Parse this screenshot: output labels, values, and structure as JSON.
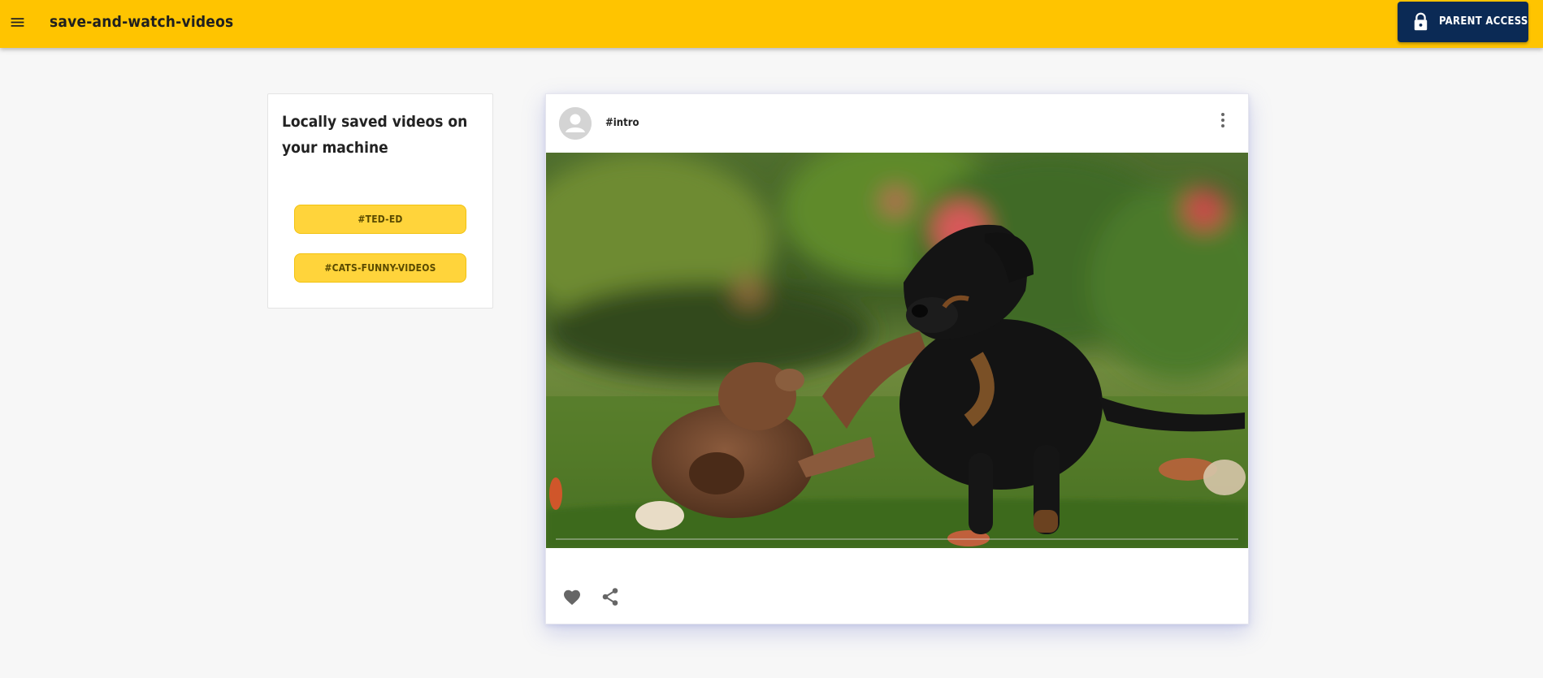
{
  "toolbar": {
    "app_title": "save-and-watch-videos",
    "parent_access_label": "PARENT ACCESS",
    "background": "#ffc400",
    "parent_button_color": "#0b2a55"
  },
  "sidebar": {
    "heading": "Locally saved videos on your machine",
    "tags": [
      {
        "label": "#TED-ED"
      },
      {
        "label": "#CATS-FUNNY-VIDEOS"
      }
    ],
    "tag_color": "#ffd43b"
  },
  "post": {
    "tag": "#intro",
    "video_content": "two puppies playing on grass"
  },
  "icons": {
    "menu": "menu-icon",
    "lock": "lock-icon",
    "avatar": "account-circle-icon",
    "more": "more-vert-icon",
    "like": "heart-icon",
    "share": "share-icon"
  }
}
